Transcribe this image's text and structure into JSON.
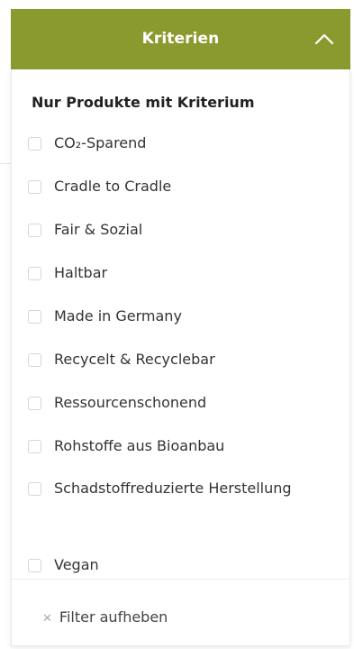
{
  "header": {
    "label": "Kriterien",
    "chevron_icon": "chevron-up-icon",
    "color": "#8a9a2f"
  },
  "panel": {
    "title": "Nur Produkte mit Kriterium",
    "options": [
      {
        "label": "CO₂-Sparend",
        "checked": false
      },
      {
        "label": "Cradle to Cradle",
        "checked": false
      },
      {
        "label": "Fair & Sozial",
        "checked": false
      },
      {
        "label": "Haltbar",
        "checked": false
      },
      {
        "label": "Made in Germany",
        "checked": false
      },
      {
        "label": "Recycelt & Recyclebar",
        "checked": false
      },
      {
        "label": "Ressourcenschonend",
        "checked": false
      },
      {
        "label": "Rohstoffe aus Bioanbau",
        "checked": false
      },
      {
        "label": "Schadstoffreduzierte Herstellung",
        "checked": false
      },
      {
        "label": "Vegan",
        "checked": false
      }
    ],
    "clear_icon": "close-icon",
    "clear_label": "Filter aufheben"
  }
}
